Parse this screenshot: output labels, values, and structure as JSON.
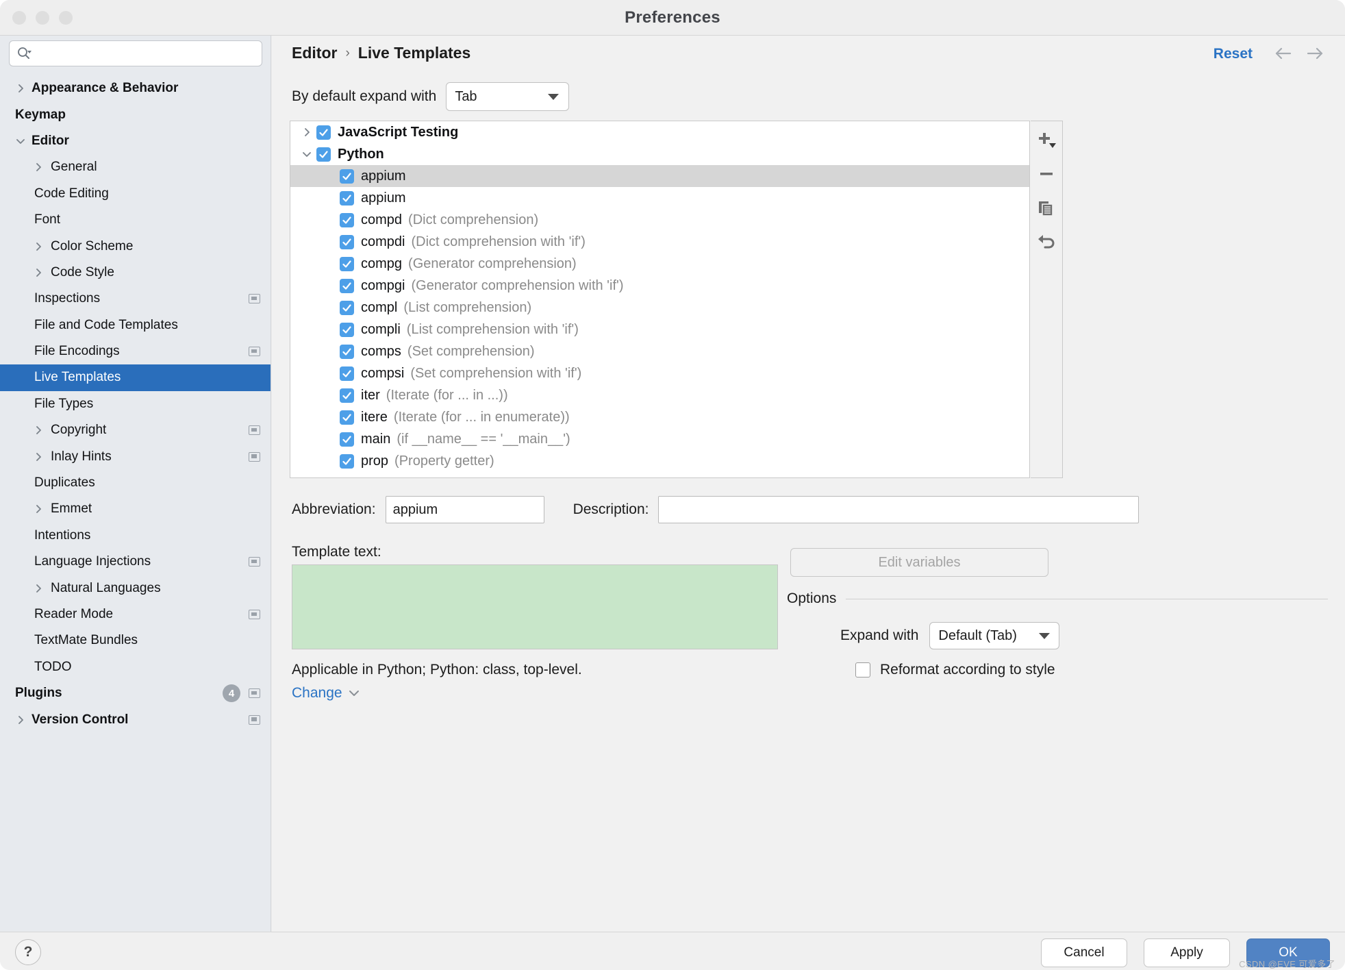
{
  "window": {
    "title": "Preferences",
    "traffic_lights": [
      "close",
      "minimize",
      "zoom"
    ]
  },
  "sidebar": {
    "search": {
      "value": "",
      "placeholder": ""
    },
    "items": [
      {
        "label": "Appearance & Behavior",
        "level": 0,
        "bold": true,
        "arrow": "right",
        "selected": false,
        "badge": null,
        "project_icon": false
      },
      {
        "label": "Keymap",
        "level": 0,
        "bold": true,
        "arrow": null,
        "selected": false,
        "badge": null,
        "project_icon": false
      },
      {
        "label": "Editor",
        "level": 0,
        "bold": true,
        "arrow": "down",
        "selected": false,
        "badge": null,
        "project_icon": false
      },
      {
        "label": "General",
        "level": 1,
        "bold": false,
        "arrow": "right",
        "selected": false,
        "badge": null,
        "project_icon": false
      },
      {
        "label": "Code Editing",
        "level": 1,
        "bold": false,
        "arrow": null,
        "selected": false,
        "badge": null,
        "project_icon": false
      },
      {
        "label": "Font",
        "level": 1,
        "bold": false,
        "arrow": null,
        "selected": false,
        "badge": null,
        "project_icon": false
      },
      {
        "label": "Color Scheme",
        "level": 1,
        "bold": false,
        "arrow": "right",
        "selected": false,
        "badge": null,
        "project_icon": false
      },
      {
        "label": "Code Style",
        "level": 1,
        "bold": false,
        "arrow": "right",
        "selected": false,
        "badge": null,
        "project_icon": false
      },
      {
        "label": "Inspections",
        "level": 1,
        "bold": false,
        "arrow": null,
        "selected": false,
        "badge": null,
        "project_icon": true
      },
      {
        "label": "File and Code Templates",
        "level": 1,
        "bold": false,
        "arrow": null,
        "selected": false,
        "badge": null,
        "project_icon": false
      },
      {
        "label": "File Encodings",
        "level": 1,
        "bold": false,
        "arrow": null,
        "selected": false,
        "badge": null,
        "project_icon": true
      },
      {
        "label": "Live Templates",
        "level": 1,
        "bold": false,
        "arrow": null,
        "selected": true,
        "badge": null,
        "project_icon": false
      },
      {
        "label": "File Types",
        "level": 1,
        "bold": false,
        "arrow": null,
        "selected": false,
        "badge": null,
        "project_icon": false
      },
      {
        "label": "Copyright",
        "level": 1,
        "bold": false,
        "arrow": "right",
        "selected": false,
        "badge": null,
        "project_icon": true
      },
      {
        "label": "Inlay Hints",
        "level": 1,
        "bold": false,
        "arrow": "right",
        "selected": false,
        "badge": null,
        "project_icon": true
      },
      {
        "label": "Duplicates",
        "level": 1,
        "bold": false,
        "arrow": null,
        "selected": false,
        "badge": null,
        "project_icon": false
      },
      {
        "label": "Emmet",
        "level": 1,
        "bold": false,
        "arrow": "right",
        "selected": false,
        "badge": null,
        "project_icon": false
      },
      {
        "label": "Intentions",
        "level": 1,
        "bold": false,
        "arrow": null,
        "selected": false,
        "badge": null,
        "project_icon": false
      },
      {
        "label": "Language Injections",
        "level": 1,
        "bold": false,
        "arrow": null,
        "selected": false,
        "badge": null,
        "project_icon": true
      },
      {
        "label": "Natural Languages",
        "level": 1,
        "bold": false,
        "arrow": "right",
        "selected": false,
        "badge": null,
        "project_icon": false
      },
      {
        "label": "Reader Mode",
        "level": 1,
        "bold": false,
        "arrow": null,
        "selected": false,
        "badge": null,
        "project_icon": true
      },
      {
        "label": "TextMate Bundles",
        "level": 1,
        "bold": false,
        "arrow": null,
        "selected": false,
        "badge": null,
        "project_icon": false
      },
      {
        "label": "TODO",
        "level": 1,
        "bold": false,
        "arrow": null,
        "selected": false,
        "badge": null,
        "project_icon": false
      },
      {
        "label": "Plugins",
        "level": 0,
        "bold": true,
        "arrow": null,
        "selected": false,
        "badge": "4",
        "project_icon": true
      },
      {
        "label": "Version Control",
        "level": 0,
        "bold": true,
        "arrow": "right",
        "selected": false,
        "badge": null,
        "project_icon": true
      }
    ]
  },
  "main": {
    "breadcrumb": {
      "root": "Editor",
      "separator": "›",
      "current": "Live Templates"
    },
    "reset_label": "Reset",
    "back_icon": "arrow-left-icon",
    "forward_icon": "arrow-right-icon",
    "expand_with": {
      "label": "By default expand with",
      "value": "Tab"
    },
    "templates": [
      {
        "type": "group",
        "label": "JavaScript Testing",
        "checked": true,
        "expanded": false,
        "selected": false
      },
      {
        "type": "group",
        "label": "Python",
        "checked": true,
        "expanded": true,
        "selected": false
      },
      {
        "type": "item",
        "label": "appium",
        "desc": "",
        "checked": true,
        "selected": true
      },
      {
        "type": "item",
        "label": "appium",
        "desc": "",
        "checked": true,
        "selected": false
      },
      {
        "type": "item",
        "label": "compd",
        "desc": "(Dict comprehension)",
        "checked": true,
        "selected": false
      },
      {
        "type": "item",
        "label": "compdi",
        "desc": "(Dict comprehension with 'if')",
        "checked": true,
        "selected": false
      },
      {
        "type": "item",
        "label": "compg",
        "desc": "(Generator comprehension)",
        "checked": true,
        "selected": false
      },
      {
        "type": "item",
        "label": "compgi",
        "desc": "(Generator comprehension with 'if')",
        "checked": true,
        "selected": false
      },
      {
        "type": "item",
        "label": "compl",
        "desc": "(List comprehension)",
        "checked": true,
        "selected": false
      },
      {
        "type": "item",
        "label": "compli",
        "desc": "(List comprehension with 'if')",
        "checked": true,
        "selected": false
      },
      {
        "type": "item",
        "label": "comps",
        "desc": "(Set comprehension)",
        "checked": true,
        "selected": false
      },
      {
        "type": "item",
        "label": "compsi",
        "desc": "(Set comprehension with 'if')",
        "checked": true,
        "selected": false
      },
      {
        "type": "item",
        "label": "iter",
        "desc": "(Iterate (for ... in ...))",
        "checked": true,
        "selected": false
      },
      {
        "type": "item",
        "label": "itere",
        "desc": "(Iterate (for ... in enumerate))",
        "checked": true,
        "selected": false
      },
      {
        "type": "item",
        "label": "main",
        "desc": "(if __name__ == '__main__')",
        "checked": true,
        "selected": false
      },
      {
        "type": "item",
        "label": "prop",
        "desc": "(Property getter)",
        "checked": true,
        "selected": false
      }
    ],
    "list_toolbar": [
      {
        "icon": "add-icon",
        "name": "add-template-button"
      },
      {
        "icon": "remove-icon",
        "name": "remove-template-button"
      },
      {
        "icon": "duplicate-icon",
        "name": "duplicate-template-button"
      },
      {
        "icon": "revert-icon",
        "name": "revert-template-button"
      }
    ],
    "form": {
      "abbreviation_label": "Abbreviation:",
      "abbreviation_value": "appium",
      "description_label": "Description:",
      "description_value": "",
      "template_text_label": "Template text:",
      "template_text_value": "",
      "edit_variables_label": "Edit variables"
    },
    "options": {
      "legend": "Options",
      "expand_with_label": "Expand with",
      "expand_with_value": "Default (Tab)",
      "reformat_label": "Reformat according to style",
      "reformat_checked": false
    },
    "applicable_text": "Applicable in Python; Python: class, top-level.",
    "change_link": "Change"
  },
  "footer": {
    "help_label": "?",
    "buttons": [
      {
        "label": "Cancel",
        "primary": false,
        "name": "cancel-button"
      },
      {
        "label": "Apply",
        "primary": false,
        "name": "apply-button"
      },
      {
        "label": "OK",
        "primary": true,
        "name": "ok-button"
      }
    ],
    "watermark": "CSDN @EVE 可爱多了"
  },
  "colors": {
    "accent_blue": "#2a6ebb",
    "link_blue": "#2a73c4",
    "primary_button": "#5183c4",
    "checkbox_blue": "#4d9fe8",
    "template_green": "#c8e6c9",
    "sidebar_bg": "#e7eaee"
  }
}
